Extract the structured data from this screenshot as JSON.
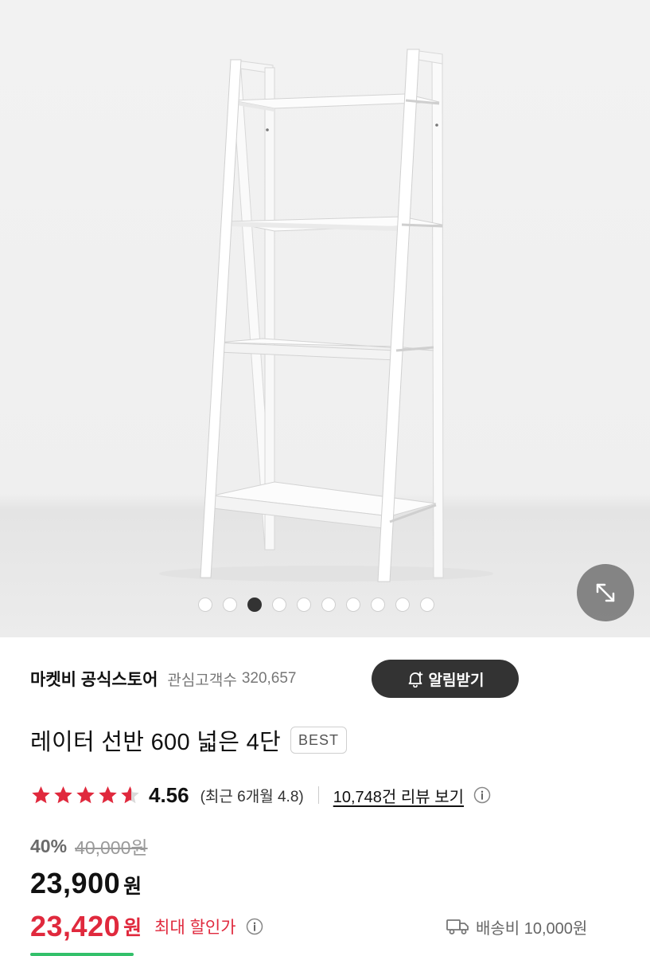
{
  "gallery": {
    "image_alt": "White 4-tier ladder shelf",
    "dot_count": 10,
    "active_dot_index": 2,
    "zoom_icon": "expand-arrows-icon"
  },
  "seller": {
    "name": "마켓비 공식스토어",
    "followers_label": "관심고객수",
    "followers_count": "320,657",
    "alert_button": "알림받기",
    "alert_icon": "bell-plus-icon"
  },
  "product": {
    "title": "레이터 선반 600 넓은 4단",
    "badge": "BEST"
  },
  "rating": {
    "stars": 4.56,
    "score": "4.56",
    "recent": "(최근 6개월 4.8)",
    "review_link": "10,748건 리뷰 보기",
    "star_color": "#e0293d"
  },
  "pricing": {
    "discount_percent": "40%",
    "original_price": "40,000원",
    "sale_price": "23,900",
    "won": "원",
    "max_discount_price": "23,420",
    "max_discount_label": "최대 할인가",
    "accent_color": "#e0293d"
  },
  "shipping": {
    "icon": "truck-icon",
    "text": "배송비 10,000원"
  }
}
